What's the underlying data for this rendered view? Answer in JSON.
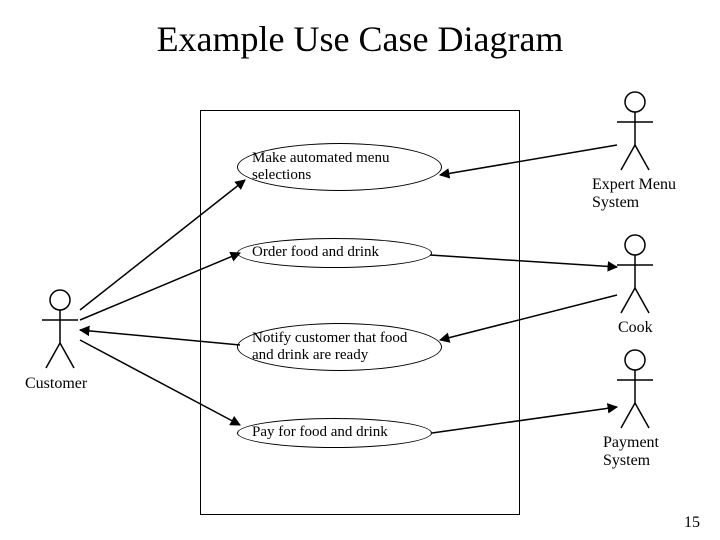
{
  "title": "Example Use Case Diagram",
  "page_number": "15",
  "usecases": {
    "uc1": "Make automated menu selections",
    "uc2": "Order food and drink",
    "uc3": "Notify customer that food and drink are ready",
    "uc4": "Pay for food and drink"
  },
  "actors": {
    "customer": "Customer",
    "expert": "Expert Menu System",
    "cook": "Cook",
    "payment": "Payment System"
  }
}
